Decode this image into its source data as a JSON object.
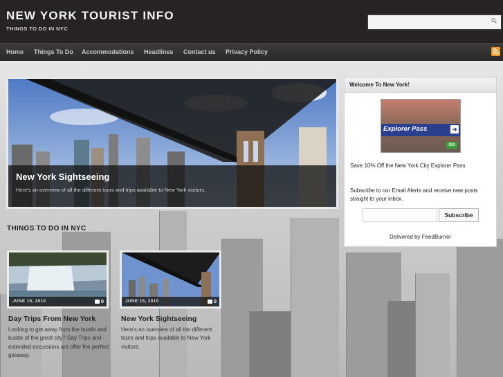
{
  "header": {
    "title": "NEW YORK TOURIST INFO",
    "tagline": "THINGS TO DO IN NYC",
    "search": {
      "value": "",
      "placeholder": "",
      "icon": "search-icon"
    }
  },
  "nav": {
    "items": [
      "Home",
      "Things To Do",
      "Accommodations",
      "Headlines",
      "Contact us",
      "Privacy Policy"
    ],
    "rss_icon": "rss-icon"
  },
  "slider": {
    "title": "New York Sightseeing",
    "description": "Here's an overview of all the different tours and trips available to New York visitors."
  },
  "section": {
    "title": "THINGS TO DO IN NYC"
  },
  "posts": [
    {
      "date": "JUNE 15, 2010",
      "comments": "0",
      "title": "Day Trips From New York",
      "excerpt": "Looking to get away from the hustle and bustle of the great city? Day Trips and extended excursions are offer the perfect getaway."
    },
    {
      "date": "JUNE 15, 2010",
      "comments": "0",
      "title": "New York Sightseeing",
      "excerpt": "Here's an overview of all the different tours and trips available to New York visitors."
    }
  ],
  "sidebar": {
    "widget_title": "Welcome To New York!",
    "promo": {
      "label": "Explorer Pass",
      "go": "GO"
    },
    "promo_caption": "Save 10% Off the New York City Explorer Pass",
    "subscribe_text": "Subscribe to our Email Alerts and receive new posts straight to your inbox.",
    "email": {
      "value": "",
      "placeholder": ""
    },
    "subscribe_button": "Subscribe",
    "delivered_by": "Delivered by FeedBurner"
  },
  "colors": {
    "header_bg": "#262322",
    "nav_bg": "#2b2928",
    "rss": "#f7931e",
    "promo_bar": "#2b3f8f"
  }
}
